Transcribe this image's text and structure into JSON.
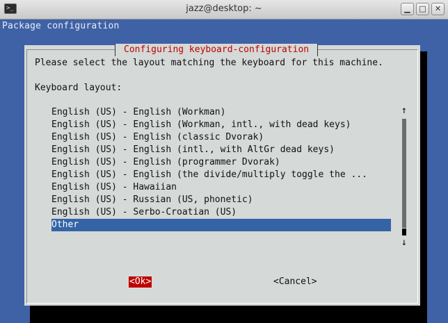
{
  "window": {
    "icon_glyph": ">_",
    "title": "jazz@desktop: ~",
    "minimize_glyph": "▁",
    "maximize_glyph": "□",
    "close_glyph": "✕"
  },
  "screen_title": "Package configuration",
  "dialog": {
    "title": "Configuring keyboard-configuration",
    "prompt": "Please select the layout matching the keyboard for this machine.",
    "list_label": "Keyboard layout:",
    "items": [
      "English (US) - English (Workman)",
      "English (US) - English (Workman, intl., with dead keys)",
      "English (US) - English (classic Dvorak)",
      "English (US) - English (intl., with AltGr dead keys)",
      "English (US) - English (programmer Dvorak)",
      "English (US) - English (the divide/multiply toggle the ...",
      "English (US) - Hawaiian",
      "English (US) - Russian (US, phonetic)",
      "English (US) - Serbo-Croatian (US)",
      "Other"
    ],
    "selected_index": 9,
    "scroll_up_glyph": "↑",
    "scroll_down_glyph": "↓",
    "ok_label": "<Ok>",
    "cancel_label": "<Cancel>"
  },
  "colors": {
    "terminal_bg": "#3f62a6",
    "dialog_bg": "#d5d9d7",
    "title_red": "#c00000",
    "selection_blue": "#3464a6"
  }
}
